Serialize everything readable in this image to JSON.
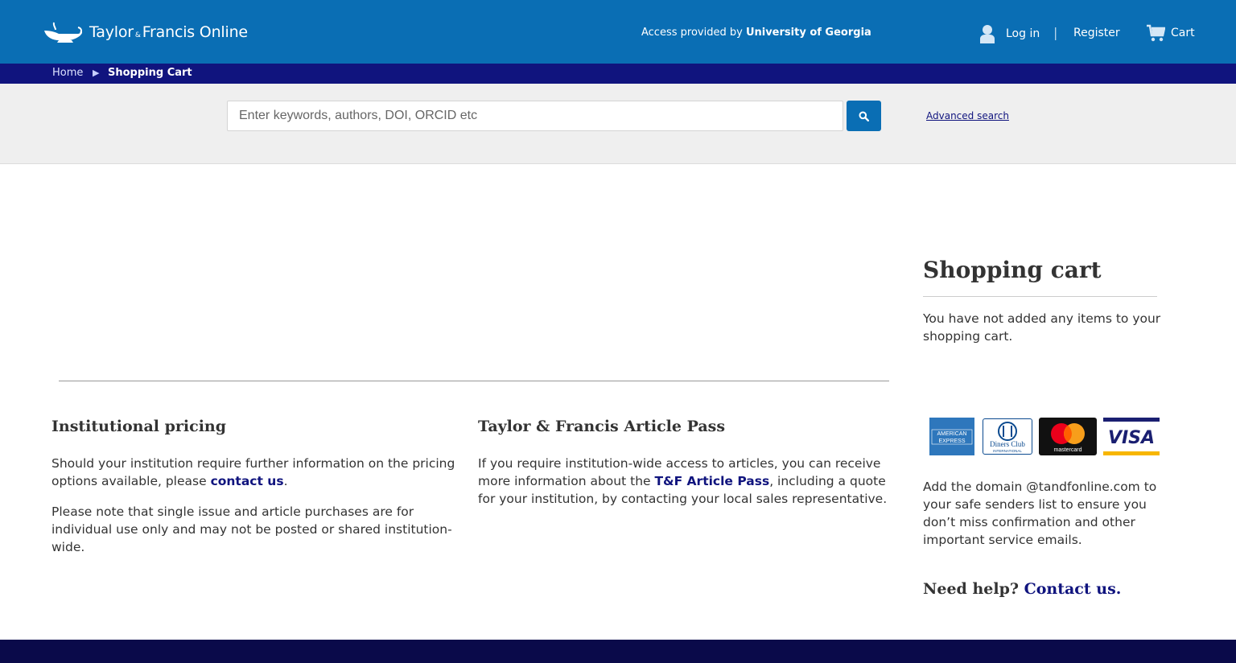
{
  "header": {
    "logo_name": "Taylor",
    "logo_amp": "&",
    "logo_rest": "Francis Online",
    "access_prefix": "Access provided by",
    "access_institution": "University of Georgia",
    "login_label": "Log in",
    "separator": "|",
    "register_label": "Register",
    "cart_label": "Cart"
  },
  "breadcrumb": {
    "home": "Home",
    "arrow": "▶",
    "current": "Shopping Cart"
  },
  "search": {
    "placeholder": "Enter keywords, authors, DOI, ORCID etc",
    "advanced_label": "Advanced search",
    "icon": "search-icon"
  },
  "institutional": {
    "title": "Institutional pricing",
    "p1_before": "Should your institution require further information on the pricing options available, please ",
    "p1_link": "contact us",
    "p1_after": ".",
    "p2": "Please note that single issue and article purchases are for individual use only and may not be posted or shared institution-wide."
  },
  "article_pass": {
    "title": "Taylor & Francis Article Pass",
    "p_before": "If you require institution-wide access to articles, you can receive more information about the ",
    "p_link": "T&F Article Pass",
    "p_after": ", including a quote for your institution, by contacting your local sales representative."
  },
  "sidebar": {
    "title": "Shopping cart",
    "empty_message": "You have not added any items to your shopping cart.",
    "cards": [
      {
        "name": "amex",
        "label_top": "AMERICAN",
        "label_bottom": "EXPRESS"
      },
      {
        "name": "diners",
        "label_top": "Diners Club",
        "label_bottom": "INTERNATIONAL"
      },
      {
        "name": "mastercard",
        "label": "mastercard"
      },
      {
        "name": "visa",
        "label": "VISA"
      }
    ],
    "safe_senders": "Add the domain @tandfonline.com to your safe senders list to ensure you don’t miss confirmation and other important service emails.",
    "help_prefix": "Need help?",
    "help_link": "Contact us."
  },
  "colors": {
    "header_blue": "#0a6eb4",
    "breadcrumb_navy": "#10147e",
    "link_navy": "#10147e",
    "footer_navy": "#0a0a4a"
  }
}
